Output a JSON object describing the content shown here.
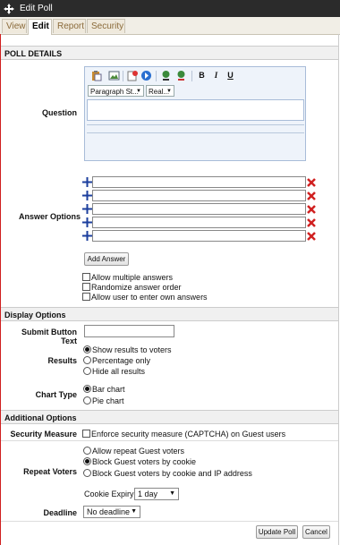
{
  "window": {
    "title": "Edit Poll",
    "icon": "move-icon"
  },
  "tabs": [
    "View",
    "Edit",
    "Report",
    "Security"
  ],
  "sections": {
    "poll_details": "POLL DETAILS",
    "display_options": "Display Options",
    "additional_options": "Additional Options"
  },
  "question": {
    "label": "Question",
    "paragraph_style": "Paragraph St...",
    "font": "Real...",
    "toolbar_icons": [
      "paste-icon",
      "image-icon",
      "insert-media-icon",
      "flash-icon",
      "link-icon",
      "unlink-icon",
      "bold-icon",
      "italic-icon",
      "underline-icon"
    ],
    "bold": "B",
    "italic": "I",
    "underline": "U"
  },
  "answers": {
    "label": "Answer Options",
    "rows": [
      "",
      "",
      "",
      "",
      ""
    ],
    "add_button": "Add Answer",
    "options": [
      "Allow multiple answers",
      "Randomize answer order",
      "Allow user to enter own answers"
    ]
  },
  "display": {
    "submit_label": "Submit Button Text",
    "submit_value": "",
    "results_label": "Results",
    "results_options": [
      "Show results to voters",
      "Percentage only",
      "Hide all results"
    ],
    "results_selected": 0,
    "chart_label": "Chart Type",
    "chart_options": [
      "Bar chart",
      "Pie chart"
    ],
    "chart_selected": 0
  },
  "additional": {
    "security_label": "Security Measure",
    "security_option": "Enforce security measure (CAPTCHA) on Guest users",
    "repeat_label": "Repeat Voters",
    "repeat_options": [
      "Allow repeat Guest voters",
      "Block Guest voters by cookie",
      "Block Guest voters by cookie and IP address"
    ],
    "repeat_selected": 1,
    "cookie_label": "Cookie Expiry",
    "cookie_value": "1 day",
    "deadline_label": "Deadline",
    "deadline_value": "No deadline"
  },
  "buttons": {
    "update": "Update Poll",
    "cancel": "Cancel"
  },
  "colors": {
    "titlebar": "#2b2b2b",
    "remove": "#d02020",
    "add": "#1c3f9e"
  }
}
